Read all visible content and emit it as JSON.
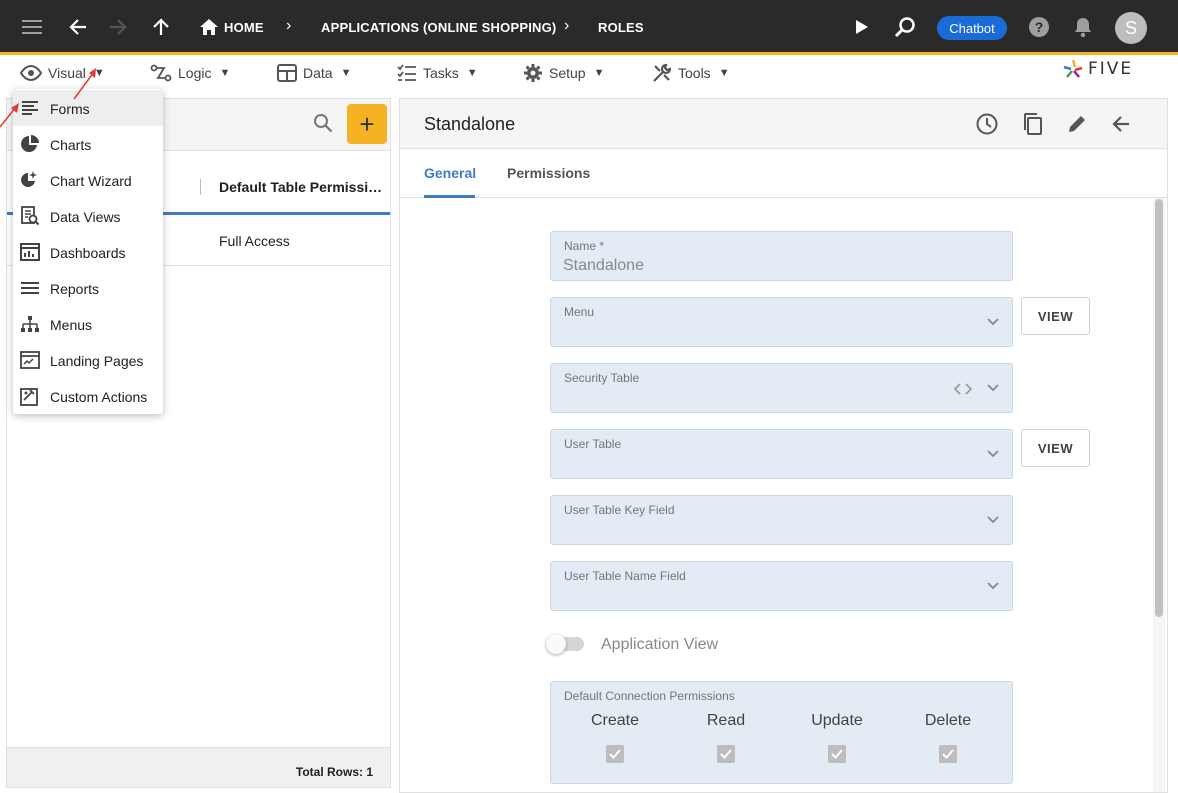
{
  "topbar": {
    "breadcrumbs": [
      "HOME",
      "APPLICATIONS (ONLINE SHOPPING)",
      "ROLES"
    ],
    "chatbot_label": "Chatbot",
    "avatar_initial": "S"
  },
  "menubar": {
    "items": [
      {
        "label": "Visual"
      },
      {
        "label": "Logic"
      },
      {
        "label": "Data"
      },
      {
        "label": "Tasks"
      },
      {
        "label": "Setup"
      },
      {
        "label": "Tools"
      }
    ],
    "logo_text": "FIVE"
  },
  "dropdown": {
    "items": [
      {
        "label": "Forms",
        "icon": "forms-icon"
      },
      {
        "label": "Charts",
        "icon": "pie-chart-icon"
      },
      {
        "label": "Chart Wizard",
        "icon": "chart-wizard-icon"
      },
      {
        "label": "Data Views",
        "icon": "data-views-icon"
      },
      {
        "label": "Dashboards",
        "icon": "dashboard-icon"
      },
      {
        "label": "Reports",
        "icon": "reports-icon"
      },
      {
        "label": "Menus",
        "icon": "menus-icon"
      },
      {
        "label": "Landing Pages",
        "icon": "landing-pages-icon"
      },
      {
        "label": "Custom Actions",
        "icon": "custom-actions-icon"
      }
    ]
  },
  "list": {
    "column_header": "Default Table Permissi…",
    "rows": [
      {
        "cell": "Full Access"
      }
    ],
    "total_rows": "Total Rows: 1"
  },
  "detail": {
    "title": "Standalone",
    "tabs": [
      {
        "label": "General"
      },
      {
        "label": "Permissions"
      }
    ],
    "fields": {
      "name_label": "Name *",
      "name_value": "Standalone",
      "menu_label": "Menu",
      "security_table_label": "Security Table",
      "user_table_label": "User Table",
      "user_table_key_label": "User Table Key Field",
      "user_table_name_label": "User Table Name Field"
    },
    "view_label": "VIEW",
    "application_view_label": "Application View",
    "application_view_on": false,
    "permissions": {
      "title": "Default Connection Permissions",
      "columns": [
        "Create",
        "Read",
        "Update",
        "Delete"
      ]
    }
  },
  "colors": {
    "accent": "#f5b324",
    "primary": "#3d7cc9",
    "chatbot": "#1a6bd8"
  }
}
